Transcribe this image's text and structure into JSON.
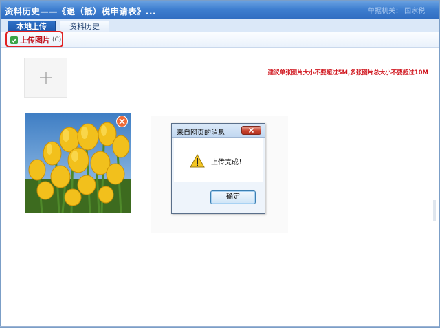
{
  "window": {
    "title": "资料历史——《退（抵）税申请表》...",
    "title_right": "单据机关：  国家税"
  },
  "tabs": [
    {
      "label": "本地上传",
      "active": true
    },
    {
      "label": "资料历史",
      "active": false
    }
  ],
  "toolbar": {
    "upload_label": "上传图片",
    "upload_shortcut": "(C)",
    "hint": "建议单张图片大小不要超过5M,多张图片总大小不要超过10M"
  },
  "icons": {
    "check": "check-icon",
    "add": "plus-icon",
    "remove": "close-icon",
    "warning": "warning-icon"
  },
  "colors": {
    "title_bar": "#3f7fd0",
    "hint_text": "#d0161e",
    "highlight": "#e12222",
    "remove_badge": "#ee6a36"
  },
  "dialog": {
    "title": "来自网页的消息",
    "message": "上传完成！",
    "ok_label": "确定"
  }
}
